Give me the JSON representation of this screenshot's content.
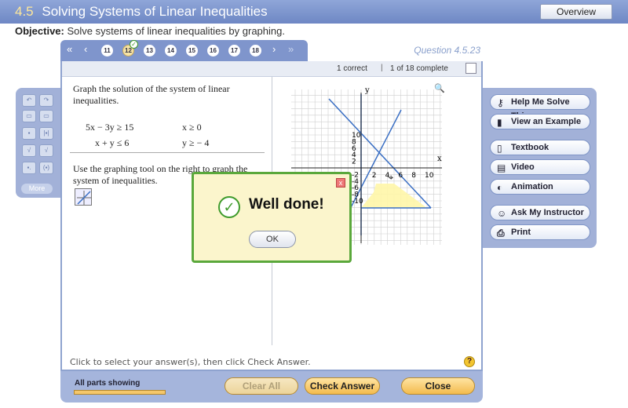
{
  "header": {
    "section": "4.5",
    "title": "Solving Systems of Linear Inequalities",
    "overview_label": "Overview"
  },
  "objective": {
    "label": "Objective:",
    "text": "Solve systems of linear inequalities by graphing."
  },
  "question_nav": {
    "numbers": [
      "11",
      "12",
      "13",
      "14",
      "15",
      "16",
      "17",
      "18"
    ],
    "current": "12",
    "label": "Question 4.5.23"
  },
  "status": {
    "correct": "1 correct",
    "complete": "1 of 18 complete"
  },
  "problem": {
    "prompt": "Graph the solution of the system of linear inequalities.",
    "ineq1": "5x − 3y ≥ 15",
    "ineq2": "x ≥ 0",
    "ineq3": "x + y ≤ 6",
    "ineq4": "y ≥ − 4",
    "instruction": "Use the graphing tool on the right to graph the system of inequalities."
  },
  "graph": {
    "x_label": "x",
    "y_label": "y",
    "x_ticks": [
      "2",
      "4",
      "6",
      "8",
      "10"
    ],
    "y_ticks": [
      "10",
      "8",
      "6",
      "4",
      "2",
      "-2",
      "-4",
      "-6",
      "-8",
      "-10"
    ]
  },
  "dialog": {
    "message": "Well done!",
    "ok_label": "OK",
    "close_label": "x"
  },
  "side_buttons": {
    "help": "Help Me Solve This",
    "example": "View an Example",
    "textbook": "Textbook",
    "video": "Video",
    "animation": "Animation",
    "instructor": "Ask My Instructor",
    "print": "Print"
  },
  "left_tools": {
    "more_label": "More"
  },
  "footer": {
    "instruction": "Click to select your answer(s), then click Check Answer.",
    "parts_showing": "All parts showing",
    "clear_all": "Clear All",
    "check_answer": "Check Answer",
    "close": "Close"
  },
  "colors": {
    "accent": "#7f95cc",
    "button_gold": "#f3bb4d",
    "success_green": "#3f9b2c",
    "dialog_bg": "#fbf5cc",
    "line_blue": "#3a6fc4",
    "shade_yellow": "#fff6a8"
  },
  "icons": {
    "first": "double-left-arrow-icon",
    "prev": "left-arrow-icon",
    "next": "right-arrow-icon",
    "last": "double-right-arrow-icon",
    "success": "checkmark-circle-icon",
    "help": "key-icon",
    "example": "book-pair-icon",
    "textbook": "book-icon",
    "video": "film-icon",
    "animation": "animation-icon",
    "instructor": "person-icon",
    "print": "printer-icon"
  }
}
